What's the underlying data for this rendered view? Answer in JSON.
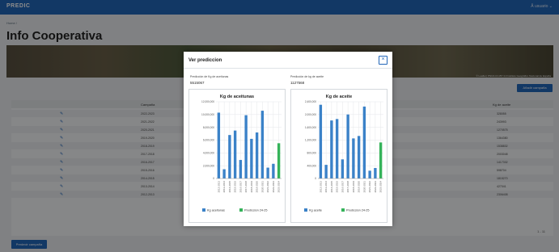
{
  "app": {
    "brand": "PREDIC",
    "user_menu": "Â usuario ⌄"
  },
  "breadcrumb": "Home /",
  "page_title": "Info Cooperativa",
  "map_attribution": "© Leaflet | PNOA CC-BY 4.0 Instituto Geográfico Nacional de España",
  "buttons": {
    "add_campaign": "Añadir campaña",
    "predict": "Predecir campaña"
  },
  "table": {
    "headers": [
      "Campaña",
      "Kg de aceite"
    ],
    "rows": [
      {
        "campaign": "2022-2023",
        "kg": "328055"
      },
      {
        "campaign": "2021-2022",
        "kg": "243993"
      },
      {
        "campaign": "2020-2021",
        "kg": "1270575"
      },
      {
        "campaign": "2019-2020",
        "kg": "1364380"
      },
      {
        "campaign": "2018-2019",
        "kg": "1538832"
      },
      {
        "campaign": "2017-2018",
        "kg": "2003048"
      },
      {
        "campaign": "2016-2017",
        "kg": "1417332"
      },
      {
        "campaign": "2015-2016",
        "kg": "598704"
      },
      {
        "campaign": "2014-2015",
        "kg": "1815270"
      },
      {
        "campaign": "2013-2014",
        "kg": "427041"
      },
      {
        "campaign": "2012-2013",
        "kg": "2306408"
      }
    ],
    "pagination": "1 - 11"
  },
  "modal": {
    "title": "Ver prediccion",
    "close_label": "×",
    "olive_label": "Predicción de Kg de aceitunas",
    "olive_value": "5515067",
    "oil_label": "Predicción de kg de aceite",
    "oil_value": "1127568"
  },
  "chart_data": [
    {
      "type": "bar",
      "title": "Kg de aceitunas",
      "categories": [
        "2012-2013",
        "2013-2014",
        "2014-2015",
        "2015-2016",
        "2016-2017",
        "2017-2018",
        "2018-2019",
        "2019-2020",
        "2020-2021",
        "2021-2022",
        "2022-2023",
        "2023-2024"
      ],
      "series": [
        {
          "name": "Kg aceitunas",
          "values": [
            10300000,
            1450000,
            6800000,
            7500000,
            2900000,
            9900000,
            6200000,
            7200000,
            10600000,
            1700000,
            2300000,
            null
          ]
        },
        {
          "name": "Prediccion 24-25",
          "values": [
            null,
            null,
            null,
            null,
            null,
            null,
            null,
            null,
            null,
            null,
            null,
            5515067
          ]
        }
      ],
      "ylim": [
        0,
        12000000
      ],
      "yticks": [
        "0",
        "2,000,000",
        "4,000,000",
        "6,000,000",
        "8,000,000",
        "10,000,000",
        "12,000,000"
      ],
      "colors": {
        "series": "#3b82c8",
        "prediction": "#35b35a"
      }
    },
    {
      "type": "bar",
      "title": "Kg de aceite",
      "categories": [
        "2012-2013",
        "2013-2014",
        "2014-2015",
        "2015-2016",
        "2016-2017",
        "2017-2018",
        "2018-2019",
        "2019-2020",
        "2020-2021",
        "2021-2022",
        "2022-2023",
        "2023-2024"
      ],
      "series": [
        {
          "name": "Kg aceite",
          "values": [
            2306408,
            427041,
            1815270,
            1860000,
            598704,
            2003048,
            1254000,
            1330000,
            2250000,
            243993,
            328055,
            null
          ]
        },
        {
          "name": "Prediccion 24-25",
          "values": [
            null,
            null,
            null,
            null,
            null,
            null,
            null,
            null,
            null,
            null,
            null,
            1127568
          ]
        }
      ],
      "ylim": [
        0,
        2400000
      ],
      "yticks": [
        "0",
        "400,000",
        "800,000",
        "1,200,000",
        "1,600,000",
        "2,000,000",
        "2,400,000"
      ],
      "colors": {
        "series": "#3b82c8",
        "prediction": "#35b35a"
      }
    }
  ]
}
